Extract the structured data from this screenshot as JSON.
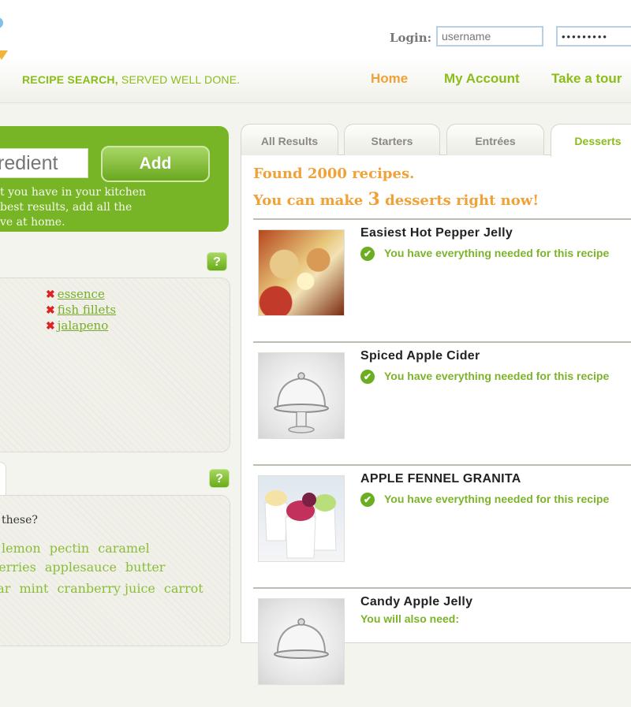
{
  "header": {
    "tagline_bold": "RECIPE SEARCH,",
    "tagline_rest": " SERVED WELL DONE.",
    "login_label": "Login:",
    "username_placeholder": "username",
    "password_value": "•••••••••",
    "nav": {
      "home": "Home",
      "account": "My Account",
      "tour": "Take a tour"
    }
  },
  "search": {
    "placeholder": "redient",
    "add_label": "Add",
    "help_lines": [
      "t you have in your kitchen",
      "best results, add all the",
      "ve at home."
    ]
  },
  "help_label": "?",
  "ingredients": [
    {
      "remove": "✖",
      "name": "essence"
    },
    {
      "remove": "✖",
      "name": "fish fillets"
    },
    {
      "remove": "✖",
      "name": "jalapeno"
    }
  ],
  "suggestions": {
    "question": "these?",
    "rows": [
      [
        "lemon",
        "pectin",
        "caramel"
      ],
      [
        "berries",
        "applesauce",
        "butter"
      ],
      [
        "gar",
        "mint",
        "cranberry juice",
        "carrot"
      ]
    ]
  },
  "tabs": {
    "all": "All Results",
    "starters": "Starters",
    "entrees": "Entrées",
    "desserts": "Desserts"
  },
  "results_summary": {
    "found": "Found 2000 recipes.",
    "can_make_prefix": "You can make ",
    "can_make_count": "3",
    "can_make_suffix": " desserts right now!"
  },
  "results": [
    {
      "title": "Easiest Hot Pepper Jelly",
      "status": "You have everything needed for this recipe",
      "icon": "check-icon",
      "thumb": "food-photo"
    },
    {
      "title": "Spiced Apple Cider",
      "status": "You have everything needed for this recipe",
      "icon": "check-icon",
      "thumb": "cake-stand"
    },
    {
      "title": "APPLE FENNEL GRANITA",
      "status": "You have everything needed for this recipe",
      "icon": "check-icon",
      "thumb": "granita-cups"
    },
    {
      "title": "Candy Apple Jelly",
      "status": "You will also need:",
      "icon": "",
      "thumb": "cake-stand"
    }
  ],
  "colors": {
    "brand_green": "#77b526",
    "accent_orange": "#f0a238",
    "link_green": "#8bbd1a"
  }
}
